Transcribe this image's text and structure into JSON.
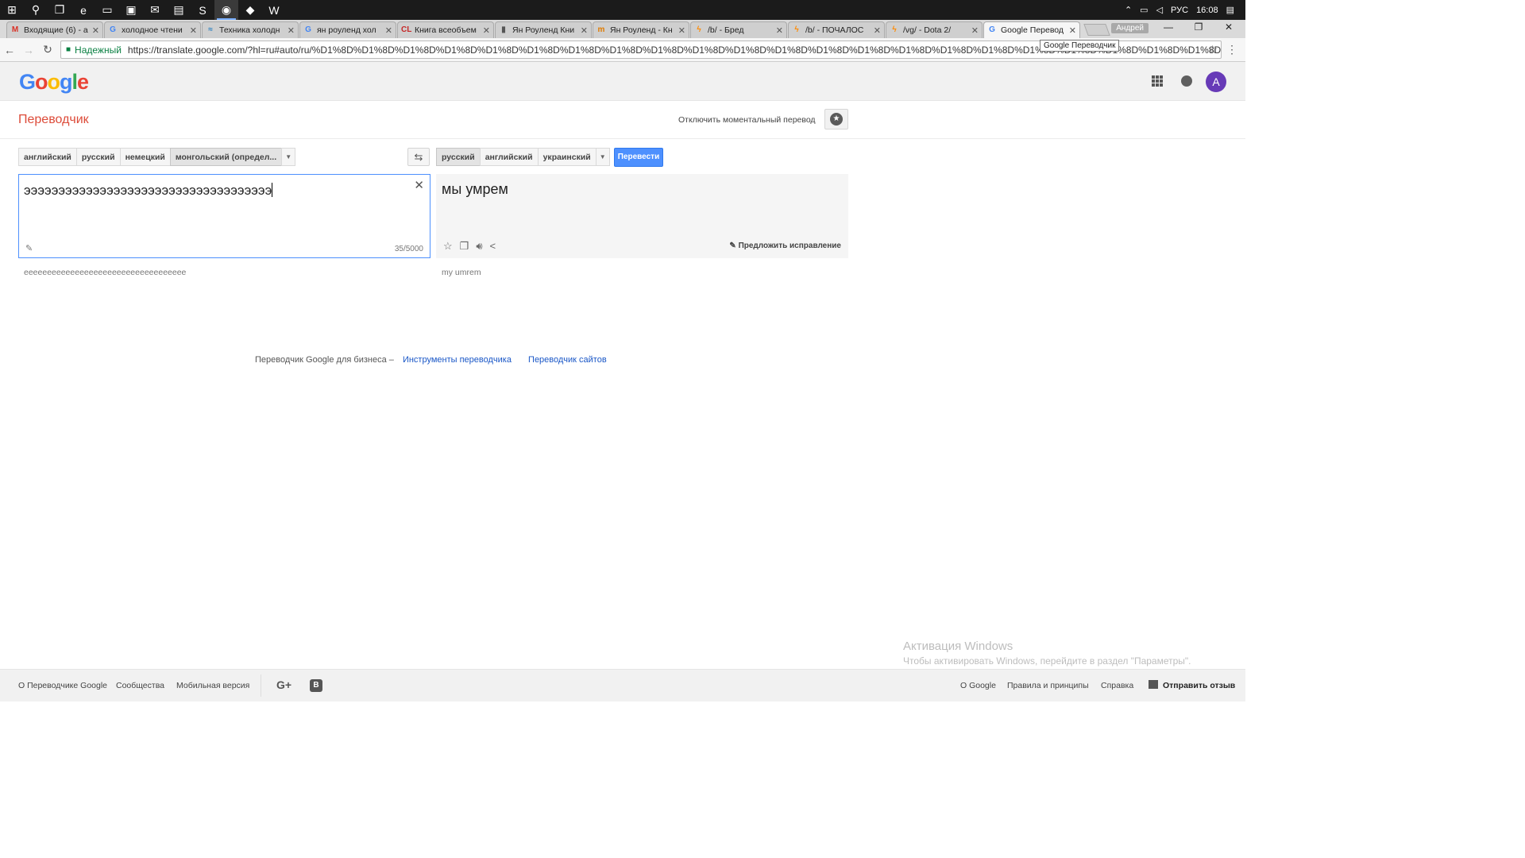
{
  "taskbar": {
    "apps": [
      {
        "name": "windows-start-icon",
        "glyph": "⊞"
      },
      {
        "name": "search-icon",
        "glyph": "⚲"
      },
      {
        "name": "task-view-icon",
        "glyph": "❐"
      },
      {
        "name": "edge-icon",
        "glyph": "e"
      },
      {
        "name": "file-explorer-icon",
        "glyph": "▭"
      },
      {
        "name": "store-icon",
        "glyph": "▣"
      },
      {
        "name": "mail-icon",
        "glyph": "✉"
      },
      {
        "name": "save-icon",
        "glyph": "▤"
      },
      {
        "name": "skype-icon",
        "glyph": "S"
      },
      {
        "name": "chrome-icon",
        "glyph": "◉",
        "active": true
      },
      {
        "name": "app-icon",
        "glyph": "◆"
      },
      {
        "name": "word-icon",
        "glyph": "W"
      }
    ],
    "lang": "РУС",
    "time": "16:08"
  },
  "browser": {
    "tabs": [
      {
        "title": "Входящие (6) - а",
        "fav": "M",
        "fav_color": "#d93025"
      },
      {
        "title": "холодное чтени",
        "fav": "G",
        "fav_color": "#4285f4"
      },
      {
        "title": "Техника холодн",
        "fav": "≈",
        "fav_color": "#2a7fbf"
      },
      {
        "title": "ян роуленд хол",
        "fav": "G",
        "fav_color": "#4285f4"
      },
      {
        "title": "Книга всеобъем",
        "fav": "CL",
        "fav_color": "#c62828"
      },
      {
        "title": "Ян Роуленд Кни",
        "fav": "▮",
        "fav_color": "#555555"
      },
      {
        "title": "Ян Роуленд - Кн",
        "fav": "m",
        "fav_color": "#e07b00"
      },
      {
        "title": "/b/ - Бред",
        "fav": "ϟ",
        "fav_color": "#ff8a00"
      },
      {
        "title": "/b/ - ПОЧАЛОС",
        "fav": "ϟ",
        "fav_color": "#ff8a00"
      },
      {
        "title": "/vg/ - Dota 2/",
        "fav": "ϟ",
        "fav_color": "#ff8a00"
      },
      {
        "title": "Google Перевод",
        "fav": "G",
        "fav_color": "#4285f4",
        "active": true
      }
    ],
    "user": "Андрей",
    "secure_label": "Надежный",
    "url": "https://translate.google.com/?hl=ru#auto/ru/%D1%8D%D1%8D%D1%8D%D1%8D%D1%8D%D1%8D%D1%8D%D1%8D%D1%8D%D1%8D%D1%8D%D1%8D%D1%8D%D1%8D%D1%8D%D1%8D%D1%8D%D1%8D%D1%8D%D1%8D%D1%8D%D1%8D%D1%8D%D1%8D%D1%8D%D1%8D%D1%8D%D1%8D%D1...",
    "tooltip": "Google Переводчик"
  },
  "google": {
    "logo": [
      {
        "ch": "G",
        "color": "#4285f4"
      },
      {
        "ch": "o",
        "color": "#ea4335"
      },
      {
        "ch": "o",
        "color": "#fbbc05"
      },
      {
        "ch": "g",
        "color": "#4285f4"
      },
      {
        "ch": "l",
        "color": "#34a853"
      },
      {
        "ch": "e",
        "color": "#ea4335"
      }
    ],
    "avatar_letter": "A"
  },
  "translator": {
    "product_name": "Переводчик",
    "instant_toggle": "Отключить моментальный перевод",
    "source_langs": [
      {
        "label": "английский",
        "selected": false
      },
      {
        "label": "русский",
        "selected": false
      },
      {
        "label": "немецкий",
        "selected": false
      },
      {
        "label": "монгольский (определ...",
        "selected": true
      }
    ],
    "target_langs": [
      {
        "label": "русский",
        "selected": true
      },
      {
        "label": "английский",
        "selected": false
      },
      {
        "label": "украинский",
        "selected": false
      }
    ],
    "translate_label": "Перевести",
    "source_text": "ээээээээээээээээээээээээээээээээээээ",
    "char_count": "35/5000",
    "source_translit": "eeeeeeeeeeeeeeeeeeeeeeeeeeeeeeeeeee",
    "result_text": "мы умрем",
    "suggest_label": "Предложить исправление",
    "result_translit": "my umrem"
  },
  "biz": {
    "prefix": "Переводчик Google для бизнеса –",
    "link1": "Инструменты переводчика",
    "link2": "Переводчик сайтов"
  },
  "activation": {
    "title": "Активация Windows",
    "subtitle": "Чтобы активировать Windows, перейдите в раздел \"Параметры\"."
  },
  "footer": {
    "about": "О Переводчике Google",
    "community": "Сообщества",
    "mobile": "Мобильная версия",
    "about_google": "О Google",
    "privacy": "Правила и принципы",
    "help": "Справка",
    "feedback": "Отправить отзыв"
  }
}
